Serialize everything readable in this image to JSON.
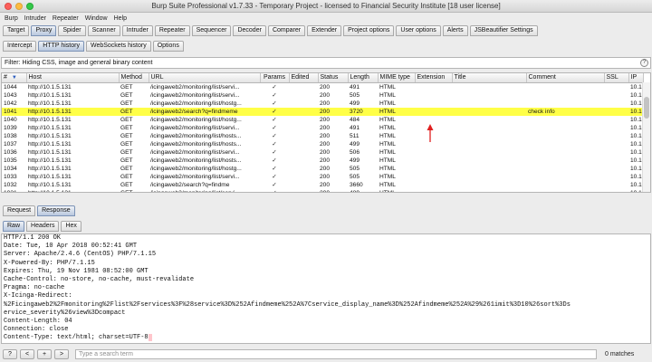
{
  "window": {
    "title": "Burp Suite Professional v1.7.33 - Temporary Project - licensed to Financial Security Institute [18 user license]"
  },
  "menu": [
    "Burp",
    "Intruder",
    "Repeater",
    "Window",
    "Help"
  ],
  "main_tabs": [
    "Target",
    "Proxy",
    "Spider",
    "Scanner",
    "Intruder",
    "Repeater",
    "Sequencer",
    "Decoder",
    "Comparer",
    "Extender",
    "Project options",
    "User options",
    "Alerts",
    "JSBeautifier Settings"
  ],
  "active_main_tab": "Proxy",
  "proxy_tabs": [
    "Intercept",
    "HTTP history",
    "WebSockets history",
    "Options"
  ],
  "active_proxy_tab": "HTTP history",
  "filter": {
    "text": "Filter: Hiding CSS, image and general binary content",
    "help": "?"
  },
  "history": {
    "columns": [
      "#",
      "Host",
      "Method",
      "URL",
      "Params",
      "Edited",
      "Status",
      "Length",
      "MIME type",
      "Extension",
      "Title",
      "Comment",
      "SSL",
      "IP"
    ],
    "sort_indicator": "▼",
    "rows": [
      {
        "num": "1044",
        "host": "http://10.1.5.131",
        "method": "GET",
        "url": "/icingaweb2/monitoring/list/servi...",
        "params": "✓",
        "status": "200",
        "length": "491",
        "mime": "HTML",
        "comment": "",
        "ip": "10.1"
      },
      {
        "num": "1043",
        "host": "http://10.1.5.131",
        "method": "GET",
        "url": "/icingaweb2/monitoring/list/servi...",
        "params": "✓",
        "status": "200",
        "length": "505",
        "mime": "HTML",
        "comment": "",
        "ip": "10.1"
      },
      {
        "num": "1042",
        "host": "http://10.1.5.131",
        "method": "GET",
        "url": "/icingaweb2/monitoring/list/hostg...",
        "params": "✓",
        "status": "200",
        "length": "499",
        "mime": "HTML",
        "comment": "",
        "ip": "10.1"
      },
      {
        "num": "1041",
        "host": "http://10.1.5.131",
        "method": "GET",
        "url": "/icingaweb2/search?q=findmeme",
        "params": "✓",
        "status": "200",
        "length": "3720",
        "mime": "HTML",
        "comment": "check info",
        "ip": "10.1",
        "highlight": true
      },
      {
        "num": "1040",
        "host": "http://10.1.5.131",
        "method": "GET",
        "url": "/icingaweb2/monitoring/list/hostg...",
        "params": "✓",
        "status": "200",
        "length": "484",
        "mime": "HTML",
        "comment": "",
        "ip": "10.1"
      },
      {
        "num": "1039",
        "host": "http://10.1.5.131",
        "method": "GET",
        "url": "/icingaweb2/monitoring/list/servi...",
        "params": "✓",
        "status": "200",
        "length": "491",
        "mime": "HTML",
        "comment": "",
        "ip": "10.1"
      },
      {
        "num": "1038",
        "host": "http://10.1.5.131",
        "method": "GET",
        "url": "/icingaweb2/monitoring/list/hosts...",
        "params": "✓",
        "status": "200",
        "length": "511",
        "mime": "HTML",
        "comment": "",
        "ip": "10.1"
      },
      {
        "num": "1037",
        "host": "http://10.1.5.131",
        "method": "GET",
        "url": "/icingaweb2/monitoring/list/hosts...",
        "params": "✓",
        "status": "200",
        "length": "499",
        "mime": "HTML",
        "comment": "",
        "ip": "10.1"
      },
      {
        "num": "1036",
        "host": "http://10.1.5.131",
        "method": "GET",
        "url": "/icingaweb2/monitoring/list/servi...",
        "params": "✓",
        "status": "200",
        "length": "506",
        "mime": "HTML",
        "comment": "",
        "ip": "10.1"
      },
      {
        "num": "1035",
        "host": "http://10.1.5.131",
        "method": "GET",
        "url": "/icingaweb2/monitoring/list/hosts...",
        "params": "✓",
        "status": "200",
        "length": "499",
        "mime": "HTML",
        "comment": "",
        "ip": "10.1"
      },
      {
        "num": "1034",
        "host": "http://10.1.5.131",
        "method": "GET",
        "url": "/icingaweb2/monitoring/list/hostg...",
        "params": "✓",
        "status": "200",
        "length": "505",
        "mime": "HTML",
        "comment": "",
        "ip": "10.1"
      },
      {
        "num": "1033",
        "host": "http://10.1.5.131",
        "method": "GET",
        "url": "/icingaweb2/monitoring/list/servi...",
        "params": "✓",
        "status": "200",
        "length": "505",
        "mime": "HTML",
        "comment": "",
        "ip": "10.1"
      },
      {
        "num": "1032",
        "host": "http://10.1.5.131",
        "method": "GET",
        "url": "/icingaweb2/search?q=findme",
        "params": "✓",
        "status": "200",
        "length": "3660",
        "mime": "HTML",
        "comment": "",
        "ip": "10.1"
      },
      {
        "num": "1031",
        "host": "http://10.1.5.131",
        "method": "GET",
        "url": "/icingaweb2/monitoring/list/servi...",
        "params": "✓",
        "status": "200",
        "length": "489",
        "mime": "HTML",
        "comment": "",
        "ip": "10.1"
      }
    ]
  },
  "reqresp_tabs": [
    "Request",
    "Response"
  ],
  "active_reqresp_tab": "Response",
  "view_tabs": [
    "Raw",
    "Headers",
    "Hex"
  ],
  "active_view_tab": "Raw",
  "response_lines": [
    "HTTP/1.1 200 OK",
    "Date: Tue, 10 Apr 2018 00:52:41 GMT",
    "Server: Apache/2.4.6 (CentOS) PHP/7.1.15",
    "X-Powered-By: PHP/7.1.15",
    "Expires: Thu, 19 Nov 1981 08:52:00 GMT",
    "Cache-Control: no-store, no-cache, must-revalidate",
    "Pragma: no-cache",
    "X-Icinga-Redirect:",
    "%2Ficingaweb2%2Fmonitoring%2Flist%2Fservices%3F%28service%3D%252Afindmeme%252A%7Cservice_display_name%3D%252Afindmeme%252A%29%261imit%3D10%26sort%3Ds",
    "ervice_severity%26view%3Dcompact",
    "Content-Length: 04",
    "Connection: close",
    "Content-Type: text/html; charset=UTF-8"
  ],
  "search": {
    "buttons": [
      "?",
      "<",
      "+",
      ">"
    ],
    "placeholder": "Type a search term",
    "matches": "0 matches"
  },
  "colors": {
    "highlight_row": "#ffff47",
    "active_tab": "#b9c8de",
    "annotation_arrow": "#e02020"
  }
}
